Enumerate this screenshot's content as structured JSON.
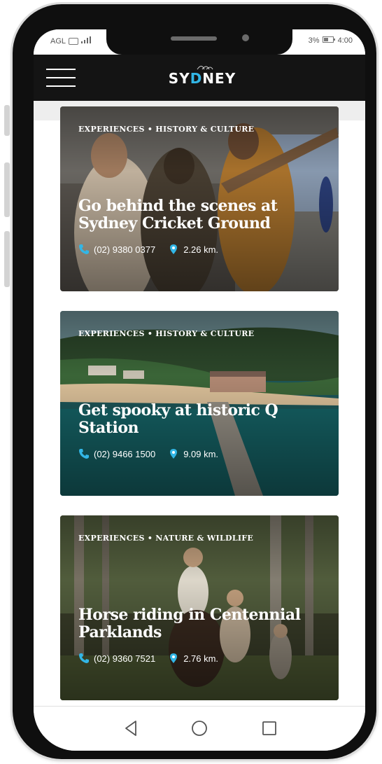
{
  "status": {
    "carrier": "AGL",
    "battery": "3%",
    "time": "4:00"
  },
  "header": {
    "logo_prefix": "SY",
    "logo_accent": "D",
    "logo_suffix": "NEY"
  },
  "cards": [
    {
      "tag": "EXPERIENCES • HISTORY & CULTURE",
      "title": "Go behind the scenes at Sydney Cricket Ground",
      "phone": "(02) 9380 0377",
      "distance": "2.26 km."
    },
    {
      "tag": "EXPERIENCES • HISTORY & CULTURE",
      "title": "Get spooky at historic Q Station",
      "phone": "(02) 9466 1500",
      "distance": "9.09 km."
    },
    {
      "tag": "EXPERIENCES • NATURE & WILDLIFE",
      "title": "Horse riding in Centennial Parklands",
      "phone": "(02) 9360 7521",
      "distance": "2.76 km."
    }
  ],
  "nav": {
    "back_icon": "back-triangle-icon",
    "home_icon": "home-circle-icon",
    "recents_icon": "recents-square-icon"
  },
  "colors": {
    "accent": "#32b6e6",
    "appbar": "#141414"
  }
}
